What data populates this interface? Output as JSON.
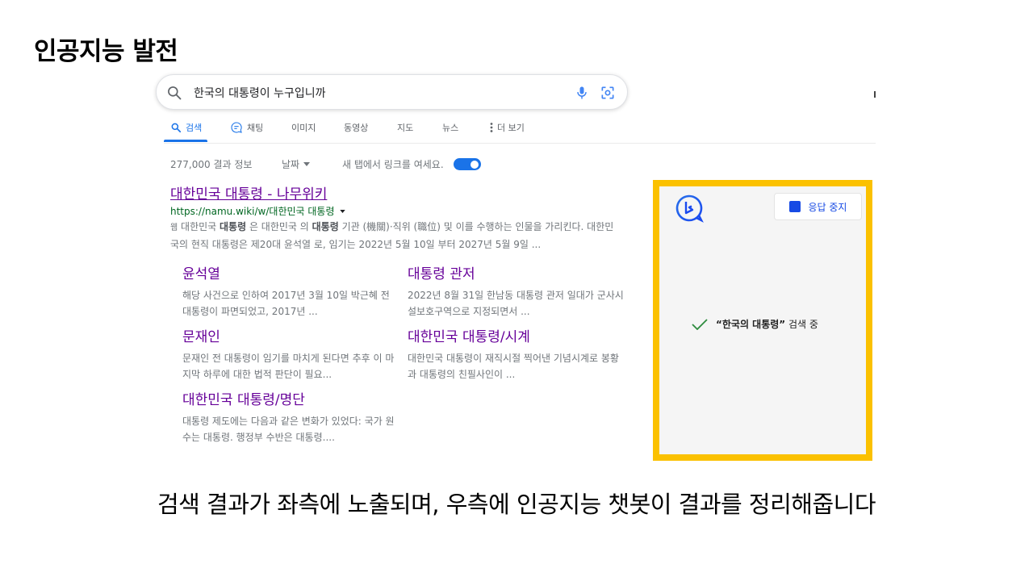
{
  "slide": {
    "title": "인공지능 발전",
    "caption": "검색 결과가 좌측에 노출되며, 우측에 인공지능 챗봇이 결과를 정리해줍니다"
  },
  "search": {
    "query": "한국의 대통령이 누구입니까",
    "icons": [
      "search-icon",
      "microphone-icon",
      "google-lens-icon"
    ]
  },
  "tabs": [
    {
      "label": "검색",
      "icon": "search-icon",
      "active": true
    },
    {
      "label": "채팅",
      "icon": "chat-icon",
      "active": false
    },
    {
      "label": "이미지",
      "active": false
    },
    {
      "label": "동영상",
      "active": false
    },
    {
      "label": "지도",
      "active": false
    },
    {
      "label": "뉴스",
      "active": false
    },
    {
      "label": "더 보기",
      "icon": "more-vert-icon",
      "active": false
    }
  ],
  "tools": {
    "result_count": "277,000 결과 정보",
    "date_filter": "날짜",
    "new_tab_label": "새 탭에서 링크를 여세요.",
    "new_tab_enabled": true
  },
  "main_result": {
    "title": "대한민국 대통령 - 나무위키",
    "url": "https://namu.wiki/w/대한민국 대통령",
    "snippet_parts": {
      "p1": "대한민국 ",
      "b1": "대통령",
      "p2": " 은 대한민국 의 ",
      "b2": "대통령",
      "p3": " 기관 (機關)·직위 (職位) 및 이를 수행하는 인물을 가리킨다. 대한민국의 현직 대통령은 제20대 윤석열 로, 임기는 2022년 5월 10일 부터 2027년 5월 9일 ..."
    },
    "web_icon": "웹"
  },
  "sublinks": [
    {
      "title": "윤석열",
      "snippet": "해당 사건으로 인하여 2017년 3월 10일 박근혜 전 대통령이 파면되었고, 2017년 ..."
    },
    {
      "title": "대통령 관저",
      "snippet": "2022년 8월 31일 한남동 대통령 관저 일대가 군사시설보호구역으로 지정되면서 ..."
    },
    {
      "title": "문재인",
      "snippet": "문재인 전 대통령이 임기를 마치게 된다면 추후 이 마지막 하루에 대한 법적 판단이 필요..."
    },
    {
      "title": "대한민국 대통령/시계",
      "snippet": "대한민국 대통령이 재직시절 찍어낸 기념시계로 봉황과 대통령의 친필사인이 ..."
    },
    {
      "title": "대한민국 대통령/명단",
      "snippet": "대통령 제도에는 다음과 같은 변화가 있었다: 국가 원수는 대통령. 행정부 수반은 대통령...."
    }
  ],
  "chat": {
    "logo": "bing-logo-icon",
    "stop_label": "응답 중지",
    "status_quote": "“한국의 대통령”",
    "status_text": " 검색 중",
    "highlight_color": "#fbc100"
  },
  "colors": {
    "accent": "#1a73e8",
    "visited_link": "#660099",
    "url_green": "#006621",
    "stop_blue": "#174ae4"
  }
}
